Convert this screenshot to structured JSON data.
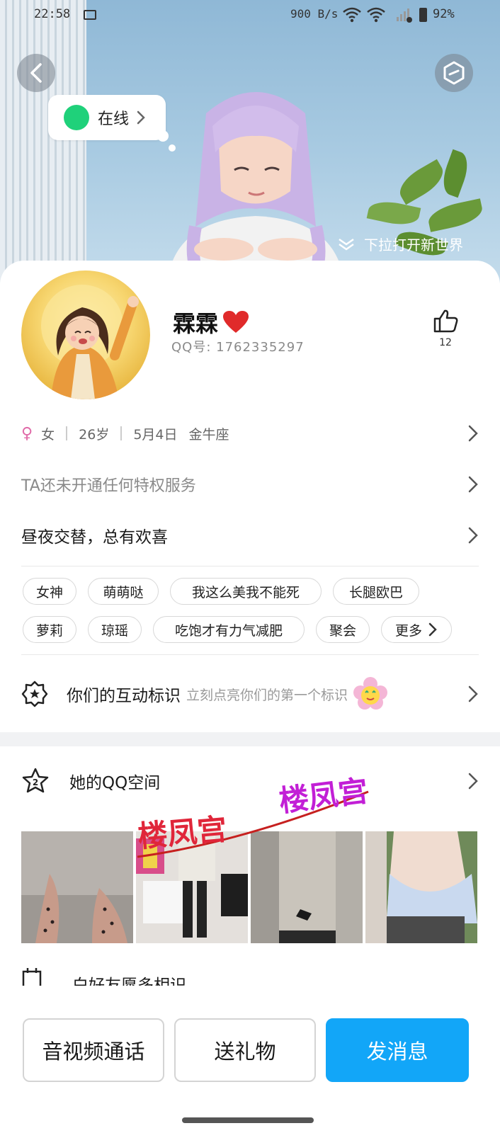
{
  "status_bar": {
    "time": "22:58",
    "network_speed": "900 B/s",
    "battery": "92%"
  },
  "hero": {
    "online_status": "在线",
    "pull_hint": "下拉打开新世界"
  },
  "profile": {
    "nickname": "霖霖",
    "qq_number": "QQ号: 1762335297",
    "like_count": "12",
    "gender": "女",
    "age": "26岁",
    "birthday": "5月4日",
    "zodiac": "金牛座",
    "vip_status": "TA还未开通任何特权服务",
    "signature": "昼夜交替，总有欢喜"
  },
  "tags": [
    "女神",
    "萌萌哒",
    "我这么美我不能死",
    "长腿欧巴",
    "萝莉",
    "琼瑶",
    "吃饱才有力气减肥",
    "聚会",
    "更多"
  ],
  "interaction": {
    "title": "你们的互动标识",
    "subtitle": "立刻点亮你们的第一个标识"
  },
  "qzone": {
    "title": "她的QQ空间",
    "level_badge": "2"
  },
  "clipped_row_text": "白好友愿多相识",
  "watermark": "楼凤宫",
  "actions": {
    "call": "音视频通话",
    "gift": "送礼物",
    "message": "发消息"
  },
  "colors": {
    "primary_blue": "#12a6f8",
    "online_green": "#1fd17a",
    "female_pink": "#e06aa8",
    "watermark_magenta": "#c21fd6"
  }
}
